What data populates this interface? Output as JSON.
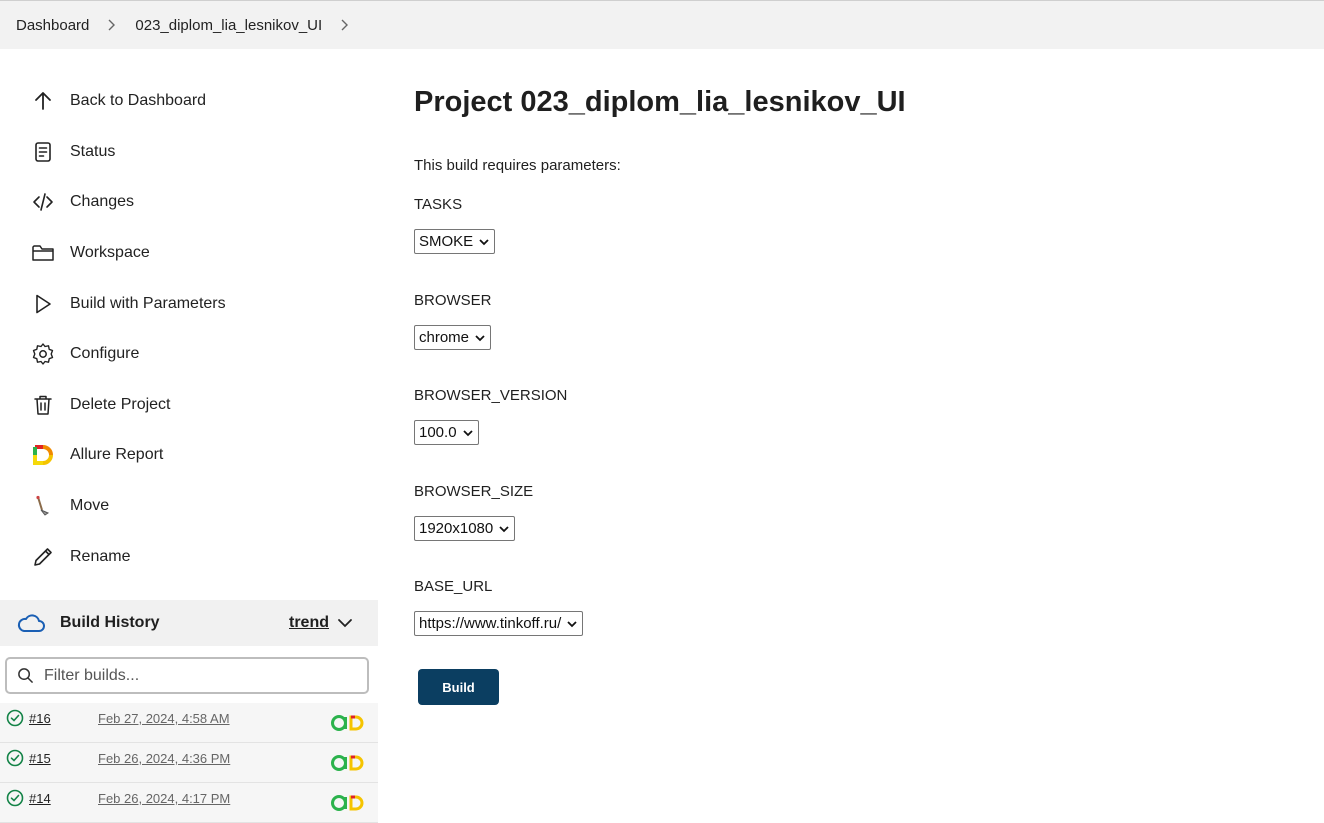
{
  "breadcrumb": {
    "items": [
      "Dashboard",
      "023_diplom_lia_lesnikov_UI"
    ]
  },
  "nav": {
    "items": [
      {
        "label": "Back to Dashboard",
        "icon": "arrow-up-icon"
      },
      {
        "label": "Status",
        "icon": "document-icon"
      },
      {
        "label": "Changes",
        "icon": "code-icon"
      },
      {
        "label": "Workspace",
        "icon": "folder-icon"
      },
      {
        "label": "Build with Parameters",
        "icon": "play-icon"
      },
      {
        "label": "Configure",
        "icon": "gear-icon"
      },
      {
        "label": "Delete Project",
        "icon": "trash-icon"
      },
      {
        "label": "Allure Report",
        "icon": "allure-icon"
      },
      {
        "label": "Move",
        "icon": "move-icon"
      },
      {
        "label": "Rename",
        "icon": "pencil-icon"
      }
    ]
  },
  "build_history": {
    "title": "Build History",
    "trend_label": "trend",
    "filter_placeholder": "Filter builds...",
    "builds": [
      {
        "number": "#16",
        "date": "Feb 27, 2024, 4:58 AM"
      },
      {
        "number": "#15",
        "date": "Feb 26, 2024, 4:36 PM"
      },
      {
        "number": "#14",
        "date": "Feb 26, 2024, 4:17 PM"
      }
    ]
  },
  "main": {
    "title": "Project 023_diplom_lia_lesnikov_UI",
    "intro": "This build requires parameters:",
    "params": [
      {
        "name": "TASKS",
        "value": "SMOKE"
      },
      {
        "name": "BROWSER",
        "value": "chrome"
      },
      {
        "name": "BROWSER_VERSION",
        "value": "100.0"
      },
      {
        "name": "BROWSER_SIZE",
        "value": "1920x1080"
      },
      {
        "name": "BASE_URL",
        "value": "https://www.tinkoff.ru/"
      }
    ],
    "build_button": "Build"
  },
  "colors": {
    "accent": "#0b3e61",
    "success": "#138347",
    "cloud": "#1a5fb4"
  }
}
